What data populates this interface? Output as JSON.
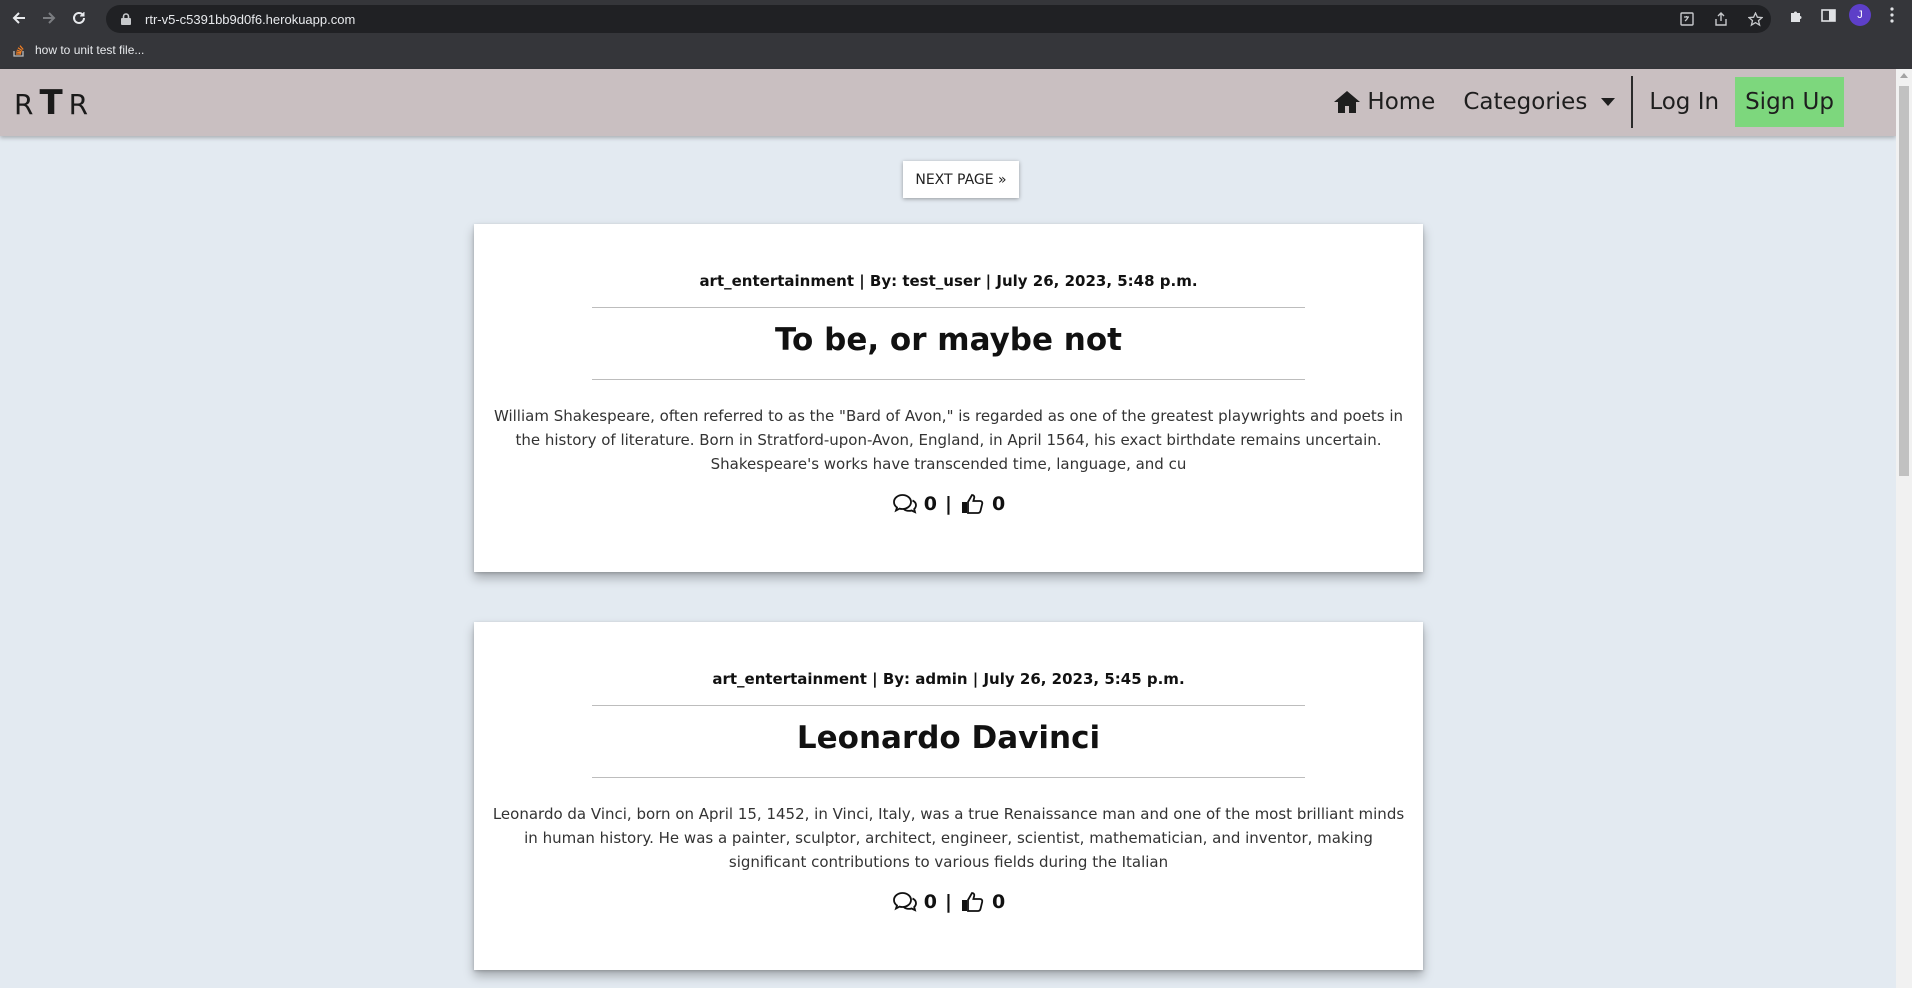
{
  "browser": {
    "url": "rtr-v5-c5391bb9d0f6.herokuapp.com",
    "bookmark": "how to unit test file...",
    "profile_initial": "J"
  },
  "nav": {
    "brand_left": "R",
    "brand_mid": "T",
    "brand_right": "R",
    "home": "Home",
    "categories": "Categories",
    "login": "Log In",
    "signup": "Sign Up",
    "signup_color": "#7dd77d",
    "bar_color": "#c9bfc1"
  },
  "pagination": {
    "next": "NEXT PAGE »"
  },
  "posts": [
    {
      "meta": "art_entertainment | By: test_user | July 26, 2023, 5:48 p.m.",
      "title": "To be, or maybe not",
      "excerpt": "William Shakespeare, often referred to as the \"Bard of Avon,\" is regarded as one of the greatest playwrights and poets in the history of literature. Born in Stratford-upon-Avon, England, in April 1564, his exact birthdate remains uncertain. Shakespeare's works have transcended time, language, and cu",
      "comments": "0",
      "separator": "|",
      "likes": "0"
    },
    {
      "meta": "art_entertainment | By: admin | July 26, 2023, 5:45 p.m.",
      "title": "Leonardo Davinci",
      "excerpt": "Leonardo da Vinci, born on April 15, 1452, in Vinci, Italy, was a true Renaissance man and one of the most brilliant minds in human history. He was a painter, sculptor, architect, engineer, scientist, mathematician, and inventor, making significant contributions to various fields during the Italian",
      "comments": "0",
      "separator": "|",
      "likes": "0"
    }
  ]
}
